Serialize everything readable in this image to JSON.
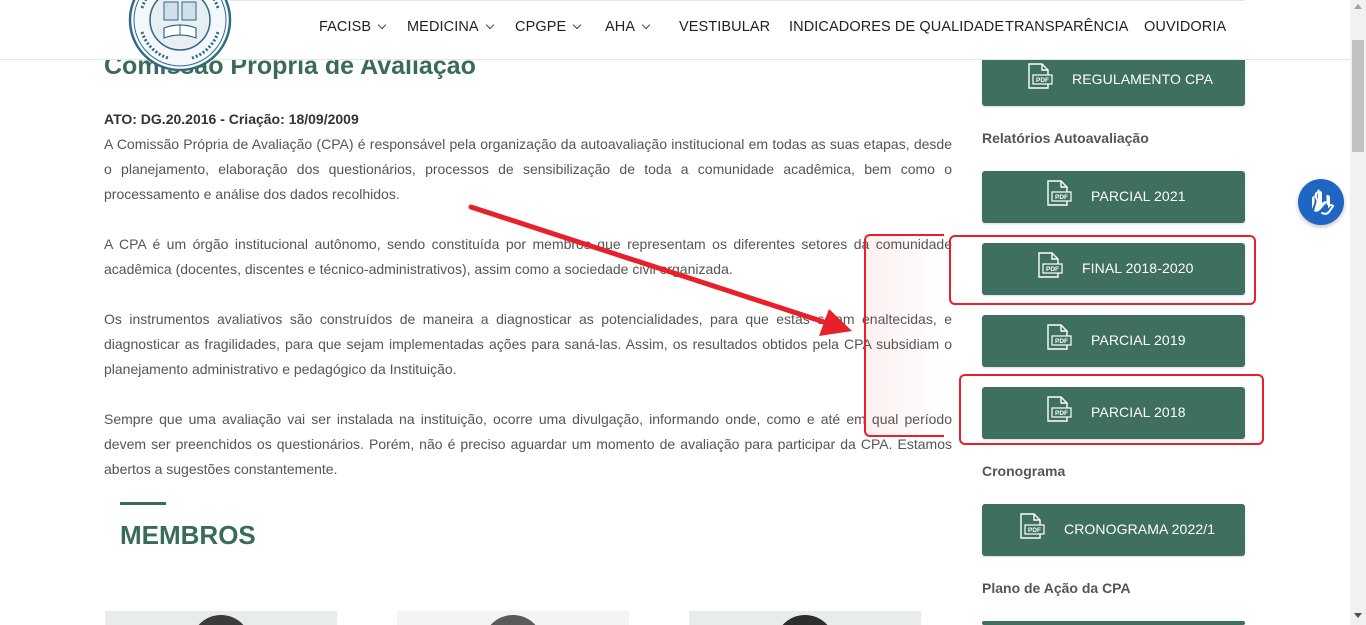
{
  "nav": {
    "items": [
      {
        "label": "FACISB",
        "dropdown": true
      },
      {
        "label": "MEDICINA",
        "dropdown": true
      },
      {
        "label": "CPGPE",
        "dropdown": true
      },
      {
        "label": "AHA",
        "dropdown": true
      },
      {
        "label": "VESTIBULAR",
        "dropdown": false
      },
      {
        "label": "INDICADORES DE QUALIDADE",
        "dropdown": false
      },
      {
        "label": "TRANSPARÊNCIA",
        "dropdown": false
      },
      {
        "label": "OUVIDORIA",
        "dropdown": false
      }
    ]
  },
  "main": {
    "title": "Comissão Própria de Avaliação",
    "ato": "ATO: DG.20.2016 - Criação: 18/09/2009",
    "paragraphs": [
      "A Comissão Própria de Avaliação (CPA) é responsável pela organização da autoavaliação institucional em todas as suas etapas, desde o planejamento, elaboração dos questionários, processos de sensibilização de toda a comunidade acadêmica, bem como o processamento e análise dos dados recolhidos.",
      "A CPA é um órgão institucional autônomo, sendo constituída por membros que representam os diferentes setores da comunidade acadêmica (docentes, discentes e técnico-administrativos), assim como a sociedade civil organizada.",
      "Os instrumentos avaliativos são construídos de maneira a diagnosticar as potencialidades, para que estas sejam enaltecidas, e diagnosticar as fragilidades, para que sejam implementadas ações para saná-las. Assim, os resultados obtidos pela CPA subsidiam o planejamento administrativo e pedagógico da Instituição.",
      "Sempre que uma avaliação vai ser instalada na instituição, ocorre uma divulgação, informando onde, como e até em qual período devem ser preenchidos os questionários. Porém, não é preciso aguardar um momento de avaliação para participar da CPA. Estamos abertos a sugestões constantemente."
    ],
    "members_title": "MEMBROS"
  },
  "sidebar": {
    "regulamento": "REGULAMENTO CPA",
    "relatorios_heading": "Relatórios Autoavaliação",
    "relatorios": [
      "PARCIAL 2021",
      "FINAL 2018-2020",
      "PARCIAL 2019",
      "PARCIAL 2018"
    ],
    "cronograma_heading": "Cronograma",
    "cronograma": "CRONOGRAMA 2022/1",
    "plano_heading": "Plano de Ação da CPA"
  },
  "icons": {
    "pdf": "pdf-file-icon",
    "accessibility": "sign-language-hands-icon",
    "logo": "institution-seal-logo"
  },
  "colors": {
    "brand_green": "#3f6f5e",
    "title_green": "#3a6b5a",
    "highlight_red": "#e8202a",
    "accessibility_blue": "#1e66c1"
  }
}
